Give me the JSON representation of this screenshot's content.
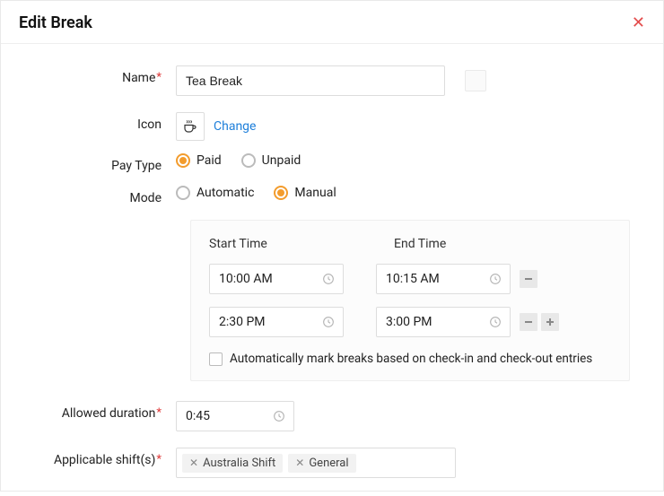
{
  "header": {
    "title": "Edit Break"
  },
  "labels": {
    "name": "Name",
    "icon": "Icon",
    "pay_type": "Pay Type",
    "mode": "Mode",
    "allowed_duration": "Allowed duration",
    "applicable_shifts": "Applicable shift(s)",
    "start_time": "Start Time",
    "end_time": "End Time"
  },
  "name": {
    "value": "Tea Break"
  },
  "icon": {
    "change_label": "Change"
  },
  "pay_type": {
    "options": [
      "Paid",
      "Unpaid"
    ],
    "selected": "Paid"
  },
  "mode": {
    "options": [
      "Automatic",
      "Manual"
    ],
    "selected": "Manual"
  },
  "time_entries": [
    {
      "start": "10:00 AM",
      "end": "10:15 AM"
    },
    {
      "start": "2:30 PM",
      "end": "3:00 PM"
    }
  ],
  "auto_mark": {
    "checked": false,
    "label": "Automatically mark breaks based on check-in and check-out entries"
  },
  "allowed_duration": {
    "value": "0:45"
  },
  "shifts": [
    {
      "label": "Australia Shift"
    },
    {
      "label": "General"
    }
  ]
}
